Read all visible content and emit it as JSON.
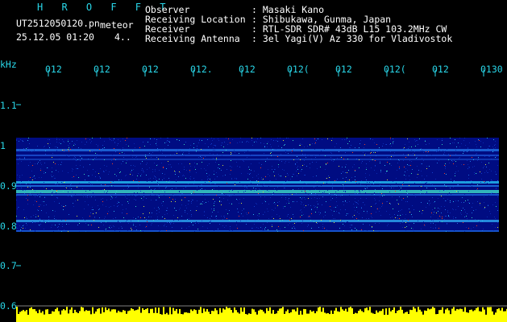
{
  "header": {
    "brand": "H R O F F T",
    "filename": "UT2512050120.pn",
    "kind": "meteor",
    "timestamp": "25.12.05 01:20",
    "index": "4..",
    "info": [
      {
        "label": "Observer",
        "value": ": Masaki Kano"
      },
      {
        "label": "Receiving Location",
        "value": ": Shibukawa, Gunma, Japan"
      },
      {
        "label": "Receiver",
        "value": ": RTL-SDR SDR# 43dB L15 103.2MHz CW"
      },
      {
        "label": "Receiving Antenna",
        "value": ": 3el Yagi(V) Az 330 for Vladivostok"
      }
    ]
  },
  "axes": {
    "y_unit": "kHz",
    "y_ticks": [
      "1.1",
      "1",
      "0.9",
      "0.8",
      "0.7",
      "0.6"
    ],
    "x_ticks": [
      "012",
      "012",
      "012",
      "012.",
      "012",
      "012(",
      "012",
      "012(",
      "012",
      "0130"
    ]
  },
  "colors": {
    "background": "#000000",
    "text": "#ffffff",
    "axis": "#29d6e8",
    "noise_floor": "#000c82",
    "amplitude": "#ffff00"
  }
}
